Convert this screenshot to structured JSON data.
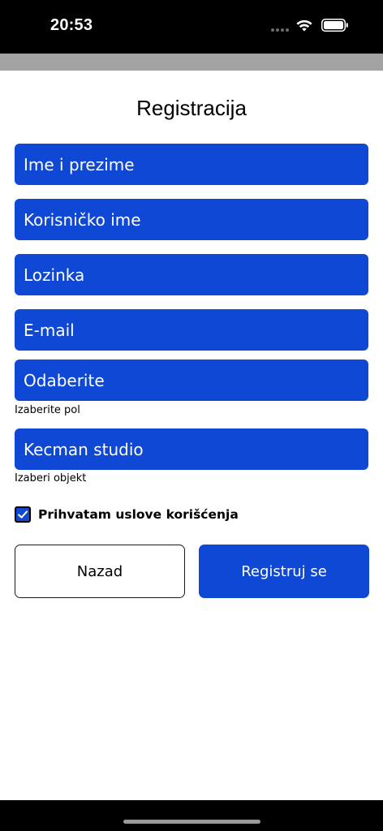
{
  "status_bar": {
    "time": "20:53"
  },
  "title": "Registracija",
  "fields": {
    "full_name": "Ime i prezime",
    "username": "Korisničko ime",
    "password": "Lozinka",
    "email": "E-mail",
    "gender": "Odaberite",
    "object": "Kecman studio"
  },
  "helpers": {
    "gender": "Izaberite pol",
    "object": "Izaberi objekt"
  },
  "terms": {
    "label": "Prihvatam uslove korišćenja",
    "checked": true
  },
  "buttons": {
    "back": "Nazad",
    "register": "Registruj se"
  },
  "colors": {
    "primary": "#0f48d4",
    "nav_band": "#a3a3a3",
    "status_bar": "#000000"
  }
}
